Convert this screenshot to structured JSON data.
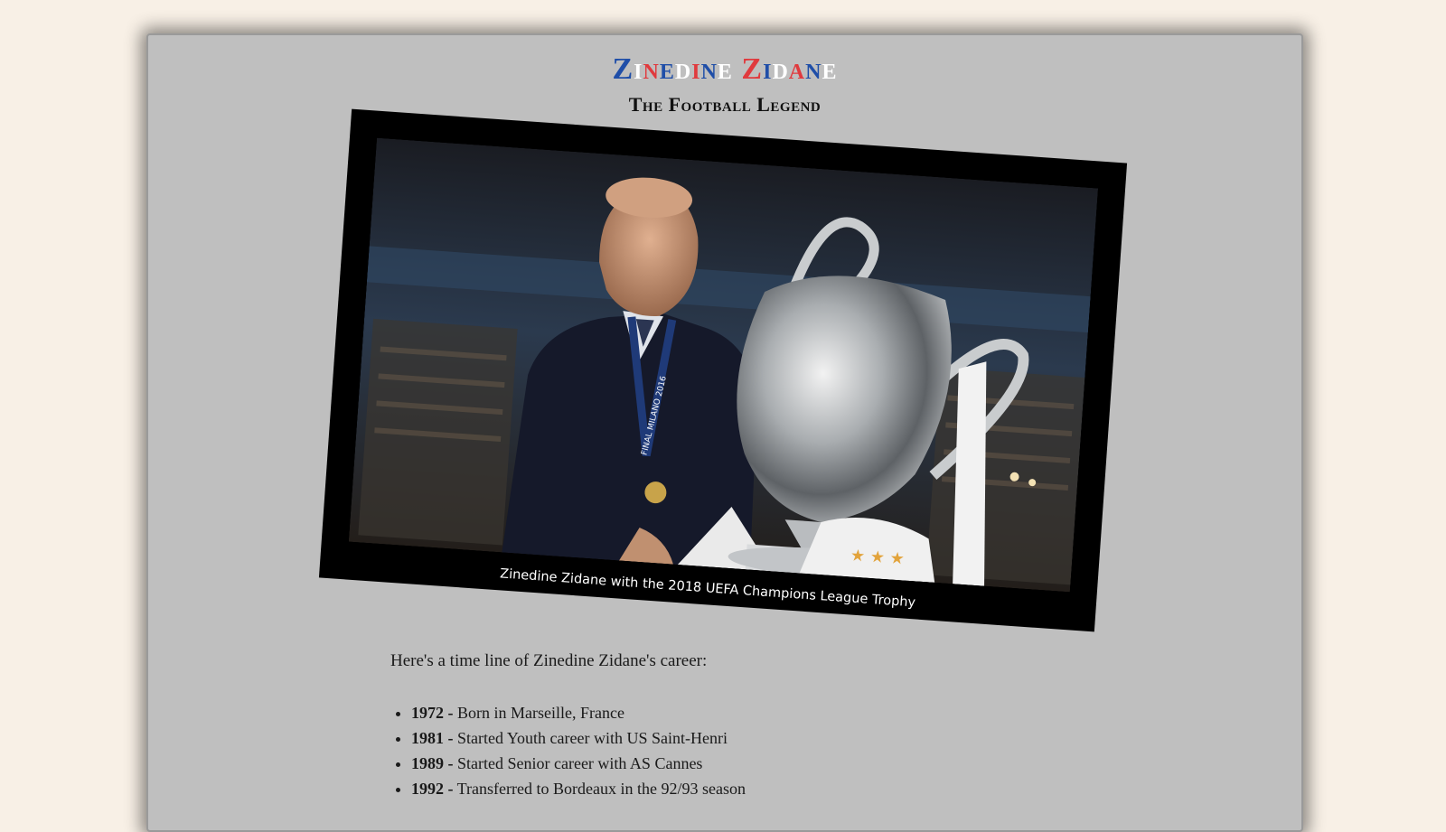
{
  "header": {
    "title_words": [
      {
        "letters": [
          {
            "ch": "Z",
            "color": "#1f4ea8"
          },
          {
            "ch": "i",
            "color": "#ffffff"
          },
          {
            "ch": "n",
            "color": "#e03a3e"
          },
          {
            "ch": "e",
            "color": "#1f4ea8"
          },
          {
            "ch": "d",
            "color": "#ffffff"
          },
          {
            "ch": "i",
            "color": "#e03a3e"
          },
          {
            "ch": "n",
            "color": "#1f4ea8"
          },
          {
            "ch": "e",
            "color": "#ffffff"
          }
        ]
      },
      {
        "letters": [
          {
            "ch": "Z",
            "color": "#e03a3e"
          },
          {
            "ch": "i",
            "color": "#1f4ea8"
          },
          {
            "ch": "d",
            "color": "#ffffff"
          },
          {
            "ch": "a",
            "color": "#e03a3e"
          },
          {
            "ch": "n",
            "color": "#1f4ea8"
          },
          {
            "ch": "e",
            "color": "#ffffff"
          }
        ]
      }
    ],
    "subtitle": "The Football Legend"
  },
  "photo": {
    "caption": "Zinedine Zidane with the 2018 UEFA Champions League Trophy",
    "medal_text": "FINAL MILANO 2016"
  },
  "content": {
    "intro": "Here's a time line of Zinedine Zidane's career:",
    "timeline": [
      {
        "year": "1972 -",
        "event": " Born in Marseille, France"
      },
      {
        "year": "1981 -",
        "event": " Started Youth career with US Saint-Henri"
      },
      {
        "year": "1989 -",
        "event": " Started Senior career with AS Cannes"
      },
      {
        "year": "1992 -",
        "event": " Transferred to Bordeaux in the 92/93 season"
      }
    ]
  }
}
